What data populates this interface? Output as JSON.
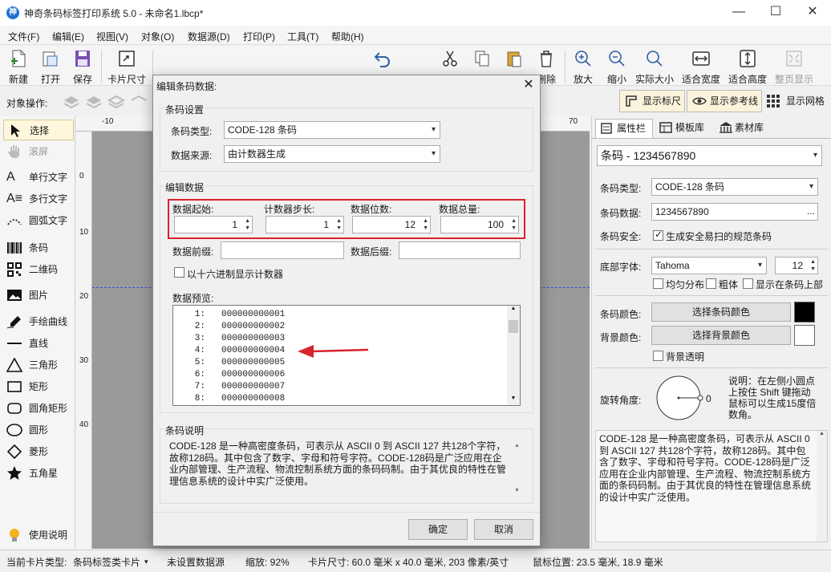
{
  "window": {
    "title": "神奇条码标签打印系统 5.0 - 未命名1.lbcp*",
    "app_icon": "神"
  },
  "menu": [
    "文件(F)",
    "编辑(E)",
    "视图(V)",
    "对象(O)",
    "数据源(D)",
    "打印(P)",
    "工具(T)",
    "帮助(H)"
  ],
  "toolbar": {
    "new": "新建",
    "open": "打开",
    "save": "保存",
    "card_size": "卡片尺寸",
    "undo": "撤销",
    "cut": "剪切",
    "copy": "复制",
    "paste": "粘贴",
    "delete": "删除",
    "zoom_in": "放大",
    "zoom_out": "缩小",
    "actual_size": "实际大小",
    "fit_width": "适合宽度",
    "fit_height": "适合高度",
    "full_page": "整页显示"
  },
  "opsbar": {
    "label": "对象操作:",
    "show_ruler": "显示标尺",
    "show_guides": "显示参考线",
    "show_grid": "显示网格"
  },
  "tools": {
    "select": "选择",
    "scroll": "滚屏",
    "single_text": "单行文字",
    "multi_text": "多行文字",
    "arc_text": "圆弧文字",
    "barcode": "条码",
    "qrcode": "二维码",
    "image": "图片",
    "freehand": "手绘曲线",
    "line": "直线",
    "triangle": "三角形",
    "rect": "矩形",
    "round_rect": "圆角矩形",
    "circle": "圆形",
    "diamond": "菱形",
    "star": "五角星",
    "help": "使用说明"
  },
  "ruler": {
    "left_tick": "-10",
    "right_tick": "70",
    "v1": "0",
    "v2": "10",
    "v3": "20",
    "v4": "30",
    "v5": "40"
  },
  "right_panel": {
    "tabs": [
      "属性栏",
      "模板库",
      "素材库"
    ],
    "object_select": "条码 - 1234567890",
    "barcode_type_label": "条码类型:",
    "barcode_type": "CODE-128 条码",
    "barcode_data_label": "条码数据:",
    "barcode_data": "1234567890",
    "ellipsis": "...",
    "safety_label": "条码安全:",
    "safety_option": "生成安全易扫的规范条码",
    "font_label": "底部字体:",
    "font": "Tahoma",
    "font_size": "12",
    "even_dist": "均匀分布",
    "bold": "粗体",
    "show_top": "显示在条码上部",
    "bar_color_label": "条码颜色:",
    "bar_color_btn": "选择条码颜色",
    "bg_color_label": "背景颜色:",
    "bg_color_btn": "选择背景颜色",
    "bg_transparent": "背景透明",
    "rotate_label": "旋转角度:",
    "rotate_value": "0",
    "rotate_note": "说明：在左侧小圆点上按住 Shift 键拖动鼠标可以生成15度倍数角。",
    "description": "CODE-128 是一种高密度条码，可表示从 ASCII 0 到 ASCII 127 共128个字符，故称128码。其中包含了数字、字母和符号字符。CODE-128码是广泛应用在企业内部管理、生产流程、物流控制系统方面的条码码制。由于其优良的特性在管理信息系统的设计中实广泛使用。",
    "colors": {
      "bar": "#000000",
      "bg": "#ffffff"
    }
  },
  "status": {
    "card_type_label": "当前卡片类型:",
    "card_type": "条码标签类卡片",
    "datasource": "未设置数据源",
    "zoom": "缩放: 92%",
    "card_size": "卡片尺寸: 60.0 毫米 x 40.0 毫米, 203 像素/英寸",
    "mouse_pos": "鼠标位置: 23.5 毫米, 18.9 毫米"
  },
  "dialog": {
    "title": "编辑条码数据:",
    "barcode_settings": "条码设置",
    "type_label": "条码类型:",
    "type_value": "CODE-128 条码",
    "source_label": "数据来源:",
    "source_value": "由计数器生成",
    "edit_data": "编辑数据",
    "start_label": "数据起始:",
    "start_value": "1",
    "step_label": "计数器步长:",
    "step_value": "1",
    "digits_label": "数据位数:",
    "digits_value": "12",
    "total_label": "数据总量:",
    "total_value": "100",
    "prefix_label": "数据前缀:",
    "suffix_label": "数据后缀:",
    "hex_option": "以十六进制显示计数器",
    "preview_label": "数据预览:",
    "preview_rows": [
      {
        "n": "1:",
        "v": "000000000001"
      },
      {
        "n": "2:",
        "v": "000000000002"
      },
      {
        "n": "3:",
        "v": "000000000003"
      },
      {
        "n": "4:",
        "v": "000000000004"
      },
      {
        "n": "5:",
        "v": "000000000005"
      },
      {
        "n": "6:",
        "v": "000000000006"
      },
      {
        "n": "7:",
        "v": "000000000007"
      },
      {
        "n": "8:",
        "v": "000000000008"
      }
    ],
    "desc_title": "条码说明",
    "desc_text": "CODE-128 是一种高密度条码，可表示从 ASCII 0 到 ASCII 127 共128个字符，故称128码。其中包含了数字、字母和符号字符。CODE-128码是广泛应用在企业内部管理、生产流程、物流控制系统方面的条码码制。由于其优良的特性在管理信息系统的设计中实广泛使用。",
    "ok": "确定",
    "cancel": "取消",
    "highlight_color": "#d9232d"
  }
}
